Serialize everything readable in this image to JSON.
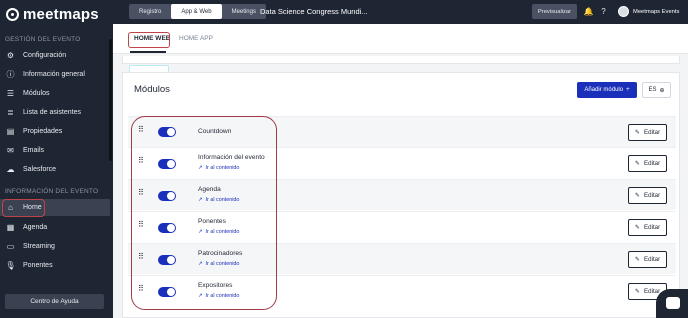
{
  "brand": {
    "name": "meetmaps"
  },
  "sidebar": {
    "section_event_management": "GESTIÓN DEL EVENTO",
    "section_event_info": "INFORMACIÓN DEL EVENTO",
    "items": [
      {
        "label": "Configuración",
        "icon": "gear-icon"
      },
      {
        "label": "Información general",
        "icon": "info-icon"
      },
      {
        "label": "Módulos",
        "icon": "menu-icon"
      },
      {
        "label": "Lista de asistentes",
        "icon": "list-icon"
      },
      {
        "label": "Propiedades",
        "icon": "properties-icon"
      },
      {
        "label": "Emails",
        "icon": "mail-icon"
      },
      {
        "label": "Salesforce",
        "icon": "cloud-icon"
      },
      {
        "label": "Home",
        "icon": "home-icon",
        "active": true
      },
      {
        "label": "Agenda",
        "icon": "calendar-icon"
      },
      {
        "label": "Streaming",
        "icon": "cast-icon"
      },
      {
        "label": "Ponentes",
        "icon": "microphone-icon"
      }
    ],
    "help_button": "Centro de Ayuda"
  },
  "topbar": {
    "tabs": [
      {
        "label": "Registro"
      },
      {
        "label": "App & Web",
        "active": true
      },
      {
        "label": "Meetings"
      }
    ],
    "event_title": "Data Science Congress Mundi...",
    "preview_button": "Previsualizar",
    "user_name": "Meetmaps Events"
  },
  "subtabs": [
    {
      "label": "HOME WEB",
      "active": true
    },
    {
      "label": "HOME APP"
    }
  ],
  "modules": {
    "title": "Módulos",
    "add_button": "Añadir módulo",
    "language": "ES",
    "edit_label": "Editar",
    "link_label": "Ir al contenido",
    "rows": [
      {
        "name": "Countdown",
        "enabled": true,
        "has_link": false
      },
      {
        "name": "Información del evento",
        "enabled": true,
        "has_link": true
      },
      {
        "name": "Agenda",
        "enabled": true,
        "has_link": true
      },
      {
        "name": "Ponentes",
        "enabled": true,
        "has_link": true
      },
      {
        "name": "Patrocinadores",
        "enabled": true,
        "has_link": true
      },
      {
        "name": "Expositores",
        "enabled": true,
        "has_link": true
      }
    ]
  },
  "colors": {
    "sidebar_bg": "#1f2633",
    "accent": "#1a2fba",
    "highlight": "#c0434b"
  }
}
